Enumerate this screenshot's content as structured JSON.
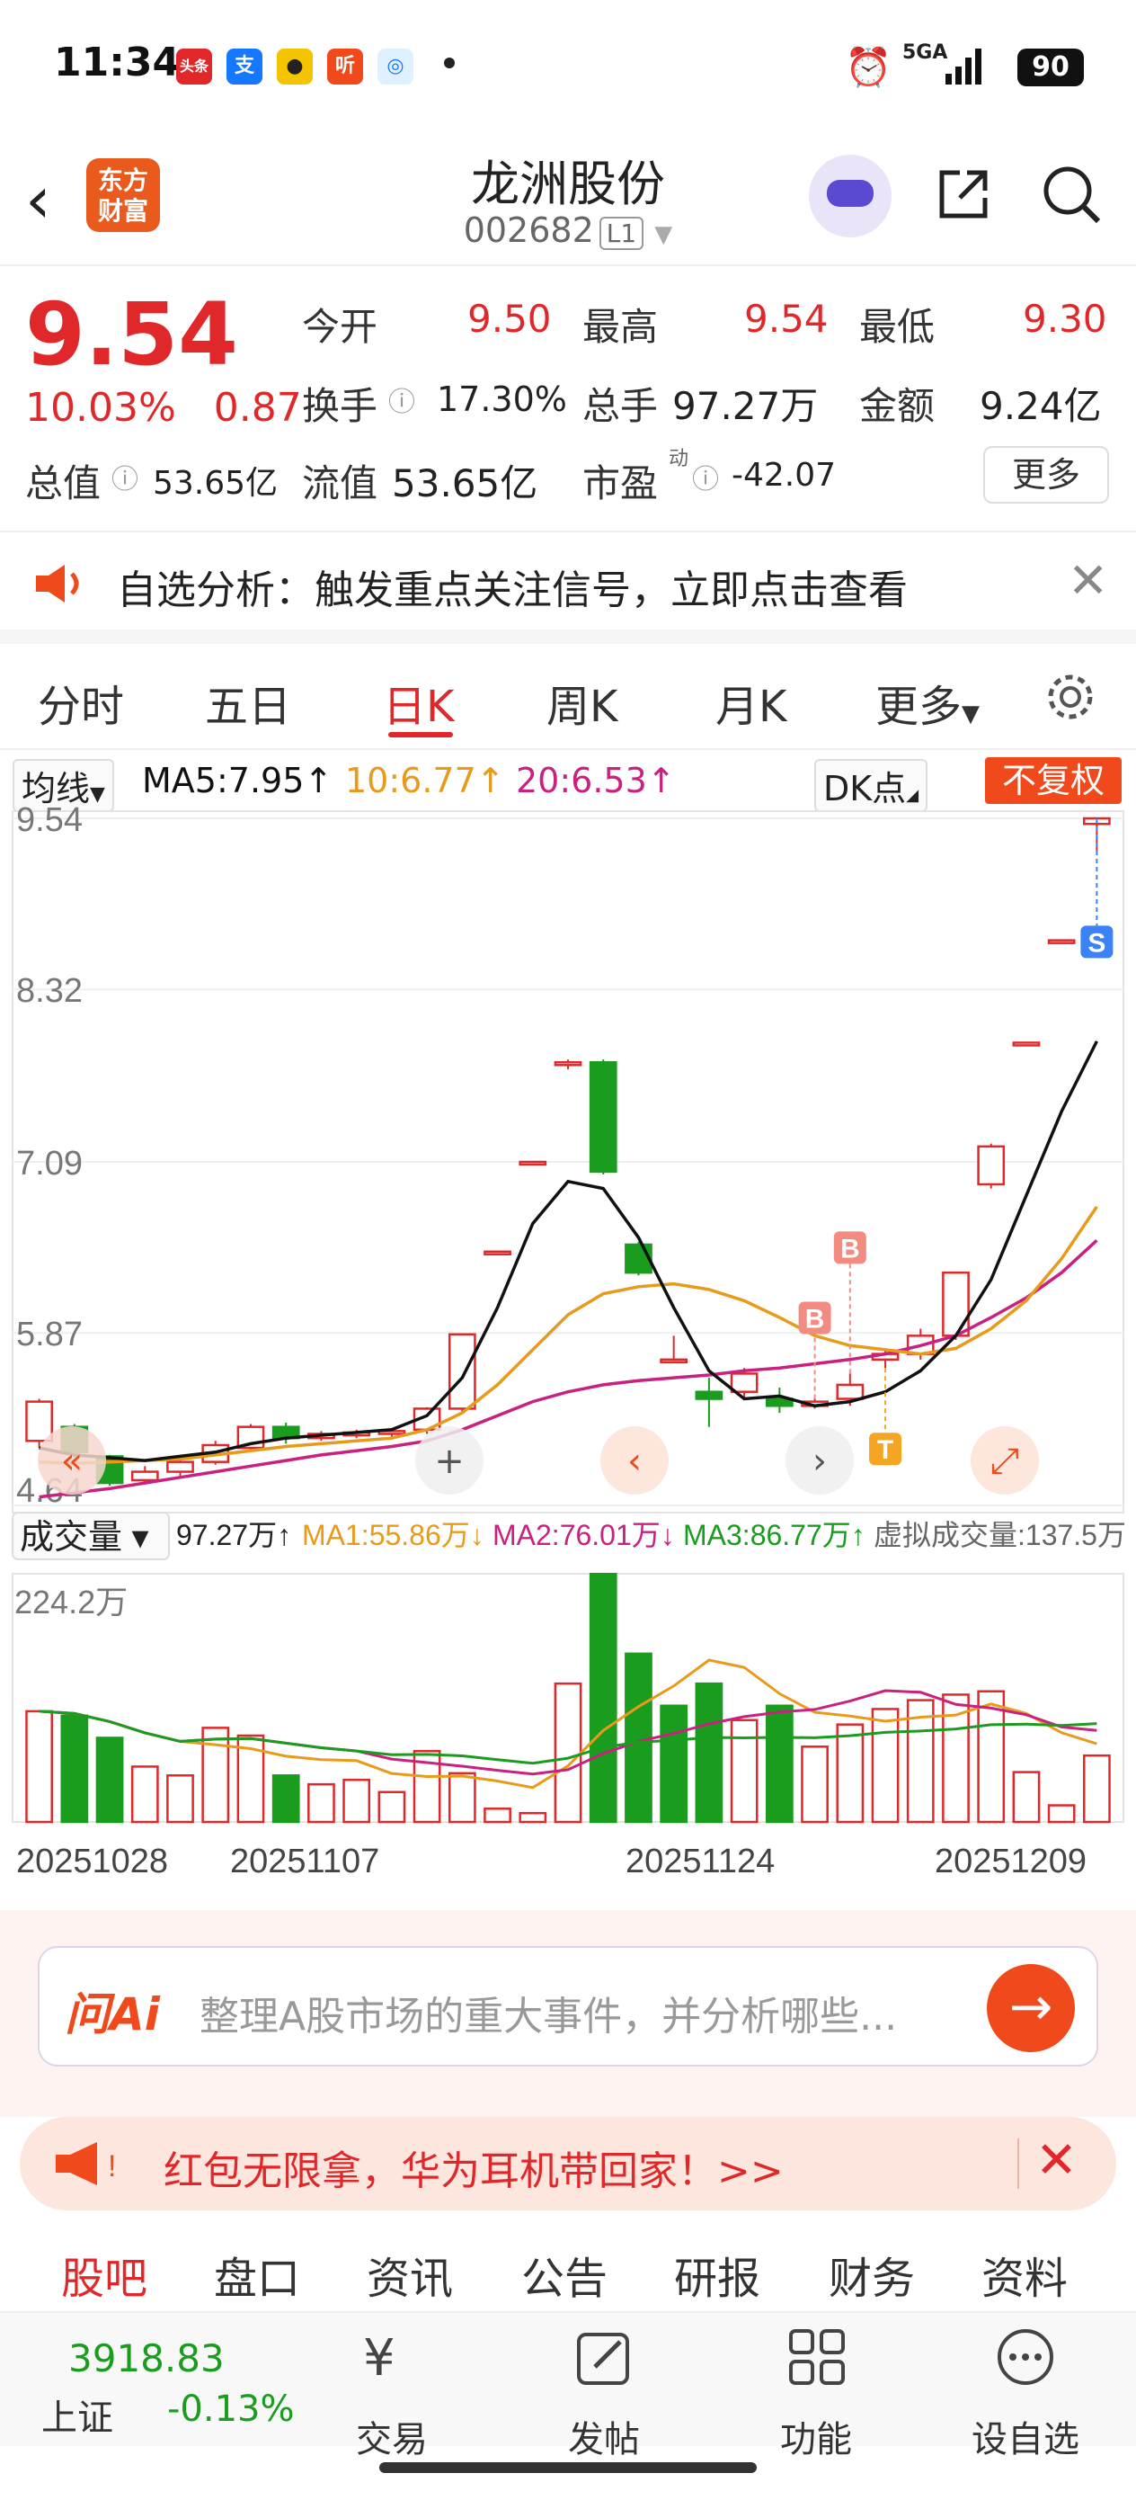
{
  "status_bar": {
    "time": "11:34",
    "apps": [
      "头条",
      "支",
      "听"
    ],
    "signal": "5GA",
    "battery": "90"
  },
  "header": {
    "logo_text": "东方财富",
    "title": "龙洲股份",
    "code": "002682",
    "level": "L1"
  },
  "quote": {
    "price": "9.54",
    "change_pct": "10.03%",
    "change_amt": "0.87",
    "open_label": "今开",
    "open": "9.50",
    "high_label": "最高",
    "high": "9.54",
    "low_label": "最低",
    "low": "9.30",
    "turnover_label": "换手",
    "turnover": "17.30%",
    "volume_label": "总手",
    "volume": "97.27万",
    "amount_label": "金额",
    "amount": "9.24亿",
    "mktcap_label": "总值",
    "mktcap": "53.65亿",
    "float_label": "流值",
    "float": "53.65亿",
    "pe_label": "市盈",
    "pe_sup": "动",
    "pe": "-42.07",
    "more": "更多"
  },
  "notice": {
    "text": "自选分析：触发重点关注信号，立即点击查看",
    "close_icon": "close-icon"
  },
  "period_tabs": [
    "分时",
    "五日",
    "日K",
    "周K",
    "月K",
    "更多"
  ],
  "active_period": "日K",
  "ma_bar": {
    "selector": "均线",
    "ma5": "MA5:7.95↑",
    "ma10": "10:6.77↑",
    "ma20": "20:6.53↑",
    "dk": "DK点",
    "fq": "不复权"
  },
  "colors": {
    "up": "#e0282a",
    "down": "#1a9c1f",
    "ma5": "#111111",
    "ma10": "#e89a1a",
    "ma20": "#c8217f",
    "accent": "#f04a1c"
  },
  "chart_data": {
    "type": "candlestick",
    "y_ticks": [
      "9.54",
      "8.32",
      "7.09",
      "5.87",
      "4.64"
    ],
    "ylim": [
      4.64,
      9.54
    ],
    "candles": [
      {
        "o": 5.1,
        "c": 5.38,
        "h": 5.4,
        "l": 5.05
      },
      {
        "o": 5.2,
        "c": 5.02,
        "h": 5.22,
        "l": 4.98
      },
      {
        "o": 4.99,
        "c": 4.8,
        "h": 5.0,
        "l": 4.78
      },
      {
        "o": 4.82,
        "c": 4.88,
        "h": 4.92,
        "l": 4.79
      },
      {
        "o": 4.88,
        "c": 4.95,
        "h": 4.97,
        "l": 4.85
      },
      {
        "o": 4.95,
        "c": 5.07,
        "h": 5.1,
        "l": 4.93
      },
      {
        "o": 5.05,
        "c": 5.2,
        "h": 5.22,
        "l": 5.02
      },
      {
        "o": 5.2,
        "c": 5.12,
        "h": 5.23,
        "l": 5.08
      },
      {
        "o": 5.12,
        "c": 5.15,
        "h": 5.17,
        "l": 5.1
      },
      {
        "o": 5.14,
        "c": 5.16,
        "h": 5.18,
        "l": 5.12
      },
      {
        "o": 5.15,
        "c": 5.17,
        "h": 5.19,
        "l": 5.13
      },
      {
        "o": 5.18,
        "c": 5.33,
        "h": 5.34,
        "l": 5.15
      },
      {
        "o": 5.33,
        "c": 5.86,
        "h": 5.86,
        "l": 5.3
      },
      {
        "o": 6.45,
        "c": 6.45,
        "h": 6.45,
        "l": 6.45
      },
      {
        "o": 7.09,
        "c": 7.09,
        "h": 7.09,
        "l": 7.09
      },
      {
        "o": 7.8,
        "c": 7.8,
        "h": 7.82,
        "l": 7.75
      },
      {
        "o": 7.8,
        "c": 7.02,
        "h": 7.82,
        "l": 7.0
      },
      {
        "o": 6.5,
        "c": 6.3,
        "h": 6.52,
        "l": 6.28
      },
      {
        "o": 5.68,
        "c": 5.68,
        "h": 5.85,
        "l": 5.66
      },
      {
        "o": 5.45,
        "c": 5.4,
        "h": 5.55,
        "l": 5.2
      },
      {
        "o": 5.45,
        "c": 5.58,
        "h": 5.62,
        "l": 5.4
      },
      {
        "o": 5.4,
        "c": 5.35,
        "h": 5.48,
        "l": 5.3
      },
      {
        "o": 5.35,
        "c": 5.38,
        "h": 5.4,
        "l": 5.33
      },
      {
        "o": 5.4,
        "c": 5.5,
        "h": 5.58,
        "l": 5.35
      },
      {
        "o": 5.68,
        "c": 5.72,
        "h": 5.75,
        "l": 5.62
      },
      {
        "o": 5.72,
        "c": 5.85,
        "h": 5.9,
        "l": 5.68
      },
      {
        "o": 5.85,
        "c": 6.3,
        "h": 6.3,
        "l": 5.82
      },
      {
        "o": 6.93,
        "c": 7.2,
        "h": 7.22,
        "l": 6.9
      },
      {
        "o": 7.94,
        "c": 7.94,
        "h": 7.94,
        "l": 7.94
      },
      {
        "o": 8.67,
        "c": 8.67,
        "h": 8.67,
        "l": 8.67
      },
      {
        "o": 9.5,
        "c": 9.54,
        "h": 9.54,
        "l": 9.3
      }
    ],
    "ma5": [
      5.05,
      5.0,
      4.98,
      4.96,
      4.99,
      5.02,
      5.08,
      5.12,
      5.14,
      5.16,
      5.18,
      5.28,
      5.55,
      6.05,
      6.65,
      6.95,
      6.9,
      6.55,
      6.05,
      5.6,
      5.4,
      5.42,
      5.35,
      5.38,
      5.45,
      5.6,
      5.85,
      6.25,
      6.85,
      7.45,
      7.95
    ],
    "ma10": [
      4.95,
      4.94,
      4.95,
      4.96,
      4.97,
      5.0,
      5.03,
      5.06,
      5.08,
      5.1,
      5.12,
      5.18,
      5.3,
      5.5,
      5.75,
      6.0,
      6.15,
      6.2,
      6.22,
      6.18,
      6.1,
      5.98,
      5.85,
      5.78,
      5.75,
      5.72,
      5.76,
      5.9,
      6.1,
      6.4,
      6.77
    ],
    "ma20": [
      4.7,
      4.73,
      4.76,
      4.8,
      4.84,
      4.88,
      4.92,
      4.96,
      5.0,
      5.03,
      5.06,
      5.1,
      5.18,
      5.28,
      5.38,
      5.45,
      5.5,
      5.53,
      5.55,
      5.57,
      5.6,
      5.62,
      5.65,
      5.68,
      5.72,
      5.78,
      5.85,
      5.98,
      6.12,
      6.3,
      6.53
    ],
    "markers": [
      {
        "label": "B",
        "index": 22
      },
      {
        "label": "B",
        "index": 23
      },
      {
        "label": "T",
        "index": 24
      },
      {
        "label": "S",
        "index": 30
      }
    ],
    "volume": {
      "label": "成交量",
      "current": "97.27万↑",
      "ma1": "MA1:55.86万↓",
      "ma2": "MA2:76.01万↓",
      "ma3": "MA3:86.77万↑",
      "virtual": "虚拟成交量:137.5万",
      "max_label": "224.2万",
      "ylim": [
        0,
        224.2
      ],
      "values": [
        100,
        96,
        76,
        50,
        42,
        85,
        78,
        42,
        34,
        38,
        27,
        64,
        44,
        12,
        8,
        125,
        224,
        152,
        105,
        125,
        92,
        105,
        68,
        88,
        102,
        110,
        115,
        118,
        45,
        15,
        60
      ],
      "up": [
        true,
        false,
        false,
        true,
        true,
        true,
        true,
        false,
        true,
        true,
        true,
        true,
        true,
        true,
        true,
        true,
        false,
        false,
        false,
        false,
        true,
        false,
        true,
        true,
        true,
        true,
        true,
        true,
        true,
        true,
        true
      ]
    },
    "dates": [
      "20251028",
      "20251107",
      "20251124",
      "20251209"
    ]
  },
  "ai_bar": {
    "logo": "问Ai",
    "placeholder": "整理A股市场的重大事件，并分析哪些..."
  },
  "promo": {
    "text": "红包无限拿，华为耳机带回家！>>"
  },
  "bottom_tabs": [
    "股吧",
    "盘口",
    "资讯",
    "公告",
    "研报",
    "财务",
    "资料"
  ],
  "dock": {
    "index_value": "3918.83",
    "index_name": "上证",
    "index_change": "-0.13%",
    "items": [
      "交易",
      "发帖",
      "功能",
      "设自选"
    ]
  }
}
